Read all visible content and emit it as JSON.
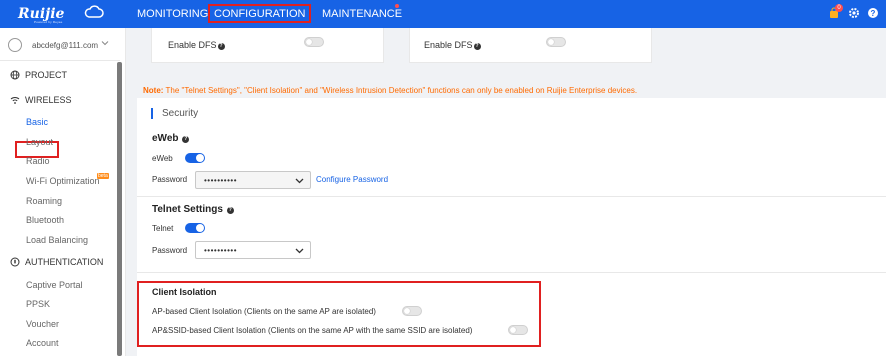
{
  "brand": {
    "logo_text": "Ruijie",
    "logo_sub": "Powered by Reyee"
  },
  "nav": {
    "monitoring": "MONITORING",
    "configuration": "CONFIGURATION",
    "maintenance": "MAINTENANCE"
  },
  "topbar": {
    "notification_count": "0"
  },
  "user": {
    "email": "abcdefg@111.com"
  },
  "sidebar": {
    "project": "PROJECT",
    "wireless": "WIRELESS",
    "wireless_items": [
      "Basic",
      "Layout",
      "Radio",
      "Wi-Fi Optimization",
      "Roaming",
      "Bluetooth",
      "Load Balancing"
    ],
    "beta_badge": "beta",
    "authentication": "AUTHENTICATION",
    "auth_items": [
      "Captive Portal",
      "PPSK",
      "Voucher",
      "Account"
    ]
  },
  "dfs": {
    "left_label": "Enable DFS",
    "right_label": "Enable DFS",
    "left_enabled": false,
    "right_enabled": false
  },
  "note": {
    "prefix": "Note:",
    "text": "The \"Telnet Settings\", \"Client Isolation\" and \"Wireless Intrusion Detection\" functions can only be enabled on Ruijie Enterprise devices."
  },
  "security": {
    "title": "Security",
    "eweb": {
      "heading": "eWeb",
      "toggle_label": "eWeb",
      "enabled": true,
      "password_label": "Password",
      "password_value": "••••••••••",
      "configure_link": "Configure Password"
    },
    "telnet": {
      "heading": "Telnet Settings",
      "toggle_label": "Telnet",
      "enabled": true,
      "password_label": "Password",
      "password_value": "••••••••••"
    },
    "client_isolation": {
      "heading": "Client Isolation",
      "ap_label": "AP-based Client Isolation (Clients on the same AP are isolated)",
      "ap_enabled": false,
      "ssid_label": "AP&SSID-based Client Isolation (Clients on the same AP with the same SSID are isolated)",
      "ssid_enabled": false
    }
  },
  "colors": {
    "primary": "#1763e5",
    "highlight": "#e02020",
    "note": "#ff6a00",
    "badge": "#ff8c1a"
  }
}
